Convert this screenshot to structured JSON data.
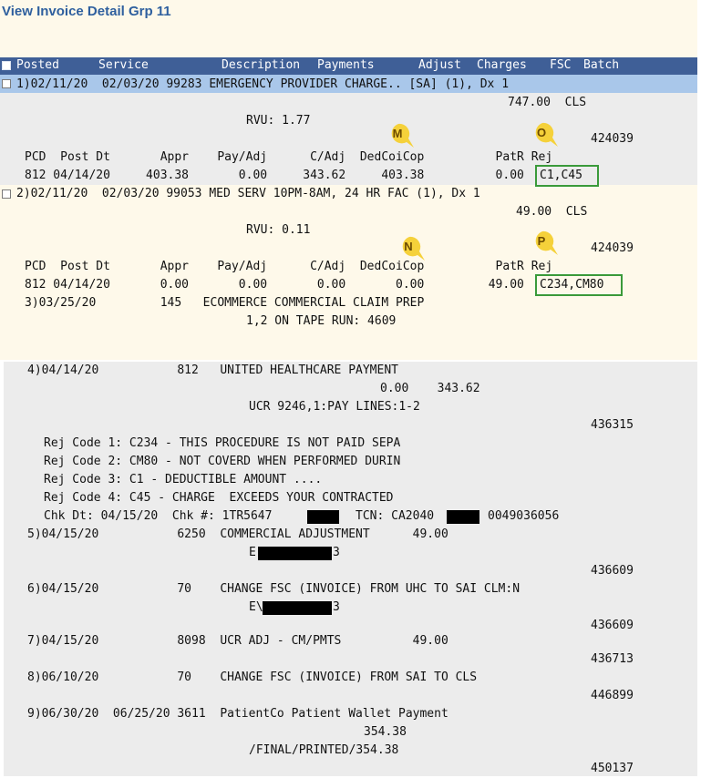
{
  "title": "View Invoice Detail Grp 11",
  "header_cols": [
    "Posted",
    "Service",
    "Description",
    "Payments",
    "Adjust",
    "Charges",
    "FSC",
    "Batch"
  ],
  "tags": [
    "M",
    "O",
    "N",
    "P"
  ],
  "lines": {
    "l1": "1)02/11/20  02/03/20 99283 EMERGENCY PROVIDER CHARGE.. [SA] (1), Dx 1",
    "l2": "747.00  CLS",
    "l3": "RVU: 1.77",
    "l4": "424039",
    "l5": "PCD  Post Dt       Appr    Pay/Adj      C/Adj  DedCoiCop          PatR Rej",
    "l6": "812 04/14/20     403.38       0.00     343.62     403.38          0.00",
    "l6rej": "C1,C45",
    "l7": "2)02/11/20  02/03/20 99053 MED SERV 10PM-8AM, 24 HR FAC (1), Dx 1",
    "l8": "49.00  CLS",
    "l9": "RVU: 0.11",
    "l10": "424039",
    "l11": "PCD  Post Dt       Appr    Pay/Adj      C/Adj  DedCoiCop          PatR Rej",
    "l12": "812 04/14/20       0.00       0.00       0.00       0.00         49.00",
    "l12rej": "C234,CM80",
    "l13": "3)03/25/20         145   ECOMMERCE COMMERCIAL CLAIM PREP",
    "l14": "1,2 ON TAPE RUN: 4609",
    "l15": "4)04/14/20           812   UNITED HEALTHCARE PAYMENT",
    "l16": "0.00    343.62",
    "l17": "UCR 9246,1:PAY LINES:1-2",
    "l18": "436315",
    "l19": "Rej Code 1: C234 - THIS PROCEDURE IS NOT PAID SEPA",
    "l20": "Rej Code 2: CM80 - NOT COVERD WHEN PERFORMED DURIN",
    "l21": "Rej Code 3: C1 - DEDUCTIBLE AMOUNT ....",
    "l22": "Rej Code 4: C45 - CHARGE  EXCEEDS YOUR CONTRACTED",
    "l23a": "Chk Dt: 04/15/20  Chk #: 1TR5647",
    "l23b": "TCN: CA2040",
    "l23c": "0049036056",
    "l24": "5)04/15/20           6250  COMMERCIAL ADJUSTMENT      49.00",
    "l25a": "E",
    "l25b": "3",
    "l26": "436609",
    "l27": "6)04/15/20           70    CHANGE FSC (INVOICE) FROM UHC TO SAI CLM:N",
    "l28a": "E\\",
    "l28b": "3",
    "l29": "436609",
    "l30": "7)04/15/20           8098  UCR ADJ - CM/PMTS          49.00",
    "l31": "436713",
    "l32": "8)06/10/20           70    CHANGE FSC (INVOICE) FROM SAI TO CLS",
    "l33": "446899",
    "l34": "9)06/30/20  06/25/20 3611  PatientCo Patient Wallet Payment",
    "l35": "354.38",
    "l36": "/FINAL/PRINTED/354.38",
    "l37": "450137"
  }
}
